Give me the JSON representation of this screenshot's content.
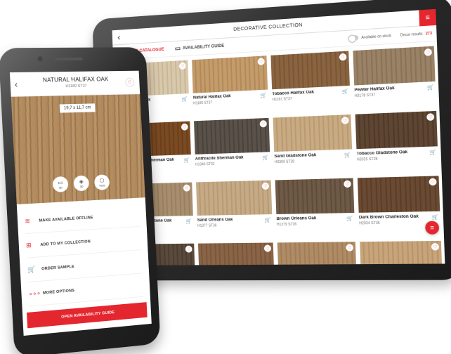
{
  "tablet": {
    "header_title": "DECORATIVE COLLECTION",
    "back_glyph": "‹",
    "menu_glyph": "≡",
    "tabs": [
      {
        "label": "DECOR CATALOGUE",
        "icon": "catalogue-icon",
        "glyph": "⚙"
      },
      {
        "label": "AVAILABILITY GUIDE",
        "icon": "document-icon",
        "glyph": "▭"
      }
    ],
    "available_on_stock_label": "Available on stock",
    "decor_results_label": "Decor results",
    "decor_results_count": "273",
    "heart_glyph": "♡",
    "cart_glyph": "🛒",
    "decors": [
      {
        "name": "White Halifax Oak",
        "code": "H1176 ST37",
        "color_a": "#d8c9ac",
        "color_b": "#c8b796"
      },
      {
        "name": "Natural Halifax Oak",
        "code": "H1180 ST37",
        "color_a": "#c49c6c",
        "color_b": "#b28a5a"
      },
      {
        "name": "Tobacco Halifax Oak",
        "code": "H1181 ST37",
        "color_a": "#8a6440",
        "color_b": "#7a5636"
      },
      {
        "name": "Pewter Halifax Oak",
        "code": "H3178 ST37",
        "color_a": "#9a8266",
        "color_b": "#8a7258"
      },
      {
        "name": "Cognac Brown Sherman Oak",
        "code": "H1344 ST32",
        "color_a": "#7a4a22",
        "color_b": "#6a3e1a"
      },
      {
        "name": "Anthracite Sherman Oak",
        "code": "H1346 ST32",
        "color_a": "#5a524a",
        "color_b": "#4a433c"
      },
      {
        "name": "Sand Gladstone Oak",
        "code": "H3309 ST28",
        "color_a": "#c9ab82",
        "color_b": "#b99a72"
      },
      {
        "name": "Tobacco Gladstone Oak",
        "code": "H3325 ST28",
        "color_a": "#5e4632",
        "color_b": "#4e3a28"
      },
      {
        "name": "Grey-Beige Gladstone Oak",
        "code": "H3326 ST28",
        "color_a": "#a88e6e",
        "color_b": "#98805f"
      },
      {
        "name": "Sand Orleans Oak",
        "code": "H1377 ST36",
        "color_a": "#c6aa86",
        "color_b": "#b69a76"
      },
      {
        "name": "Brown Orleans Oak",
        "code": "H1379 ST36",
        "color_a": "#6e5a46",
        "color_b": "#5e4c3a"
      },
      {
        "name": "Dark Brown Charleston Oak",
        "code": "H2034 ST36",
        "color_a": "#6a4a32",
        "color_b": "#5a3e28"
      },
      {
        "name": "",
        "code": "",
        "color_a": "#5a4a3c",
        "color_b": "#4a3c30"
      },
      {
        "name": "",
        "code": "",
        "color_a": "#8a6446",
        "color_b": "#7a563a"
      },
      {
        "name": "",
        "code": "",
        "color_a": "#b08c66",
        "color_b": "#a07c58"
      },
      {
        "name": "",
        "code": "",
        "color_a": "#c8a47a",
        "color_b": "#b8946a"
      }
    ]
  },
  "phone": {
    "back_glyph": "‹",
    "heart_glyph": "♡",
    "title": "NATURAL HALIFAX OAK",
    "code": "H1180 ST37",
    "dimensions": "19,7 x 11,7 cm",
    "views": [
      {
        "label": "2D",
        "icon": "2d-view-icon",
        "glyph": "▭"
      },
      {
        "label": "3D",
        "icon": "3d-cube-icon",
        "glyph": "◈"
      },
      {
        "label": "VOS",
        "icon": "vos-cube-icon",
        "glyph": "⬡"
      }
    ],
    "actions": [
      {
        "label": "MAKE AVAILABLE OFFLINE",
        "icon": "layers-icon",
        "glyph": "≋"
      },
      {
        "label": "ADD TO MY COLLECTION",
        "icon": "folder-add-icon",
        "glyph": "⊞"
      },
      {
        "label": "ORDER SAMPLE",
        "icon": "cart-icon",
        "glyph": "🛒"
      },
      {
        "label": "MORE OPTIONS",
        "icon": "more-dots-icon",
        "glyph": "∘∘∘"
      }
    ],
    "cta_label": "OPEN AVAILABILITY GUIDE"
  },
  "colors": {
    "accent": "#e4262f"
  }
}
